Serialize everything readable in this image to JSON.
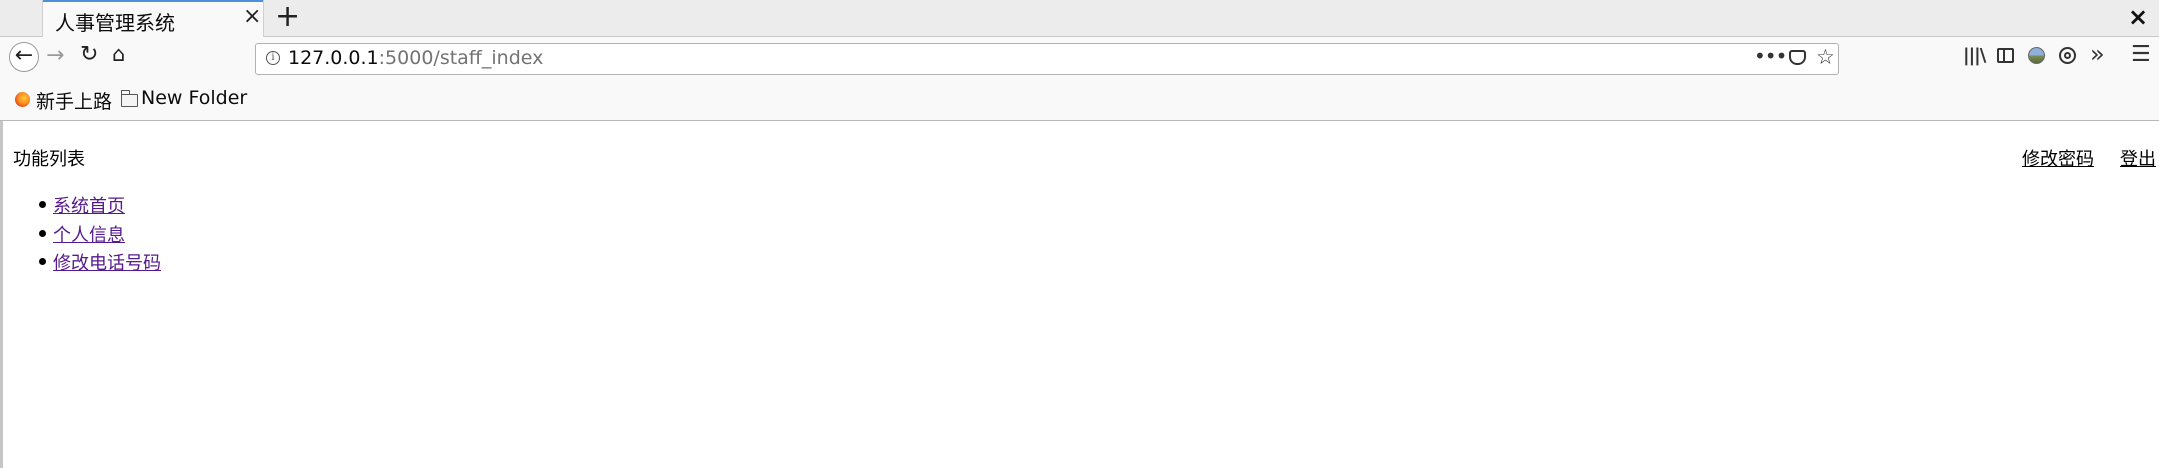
{
  "browser": {
    "tab_title": "人事管理系统",
    "tab_close_glyph": "×",
    "new_tab_glyph": "+",
    "window_close_glyph": "×",
    "url_host": "127.0.0.1",
    "url_path": ":5000/staff_index",
    "page_actions_glyph": "•••",
    "bookmarks": [
      {
        "label": "新手上路",
        "icon": "firefox-icon"
      },
      {
        "label": "New Folder",
        "icon": "folder-icon"
      }
    ],
    "accent_color": "#4c8fdb"
  },
  "page": {
    "heading": "功能列表",
    "top_links": {
      "change_password": "修改密码",
      "logout": "登出"
    },
    "menu_items": [
      {
        "label": "系统首页"
      },
      {
        "label": "个人信息"
      },
      {
        "label": "修改电话号码"
      }
    ],
    "link_color": "#551a8b"
  }
}
